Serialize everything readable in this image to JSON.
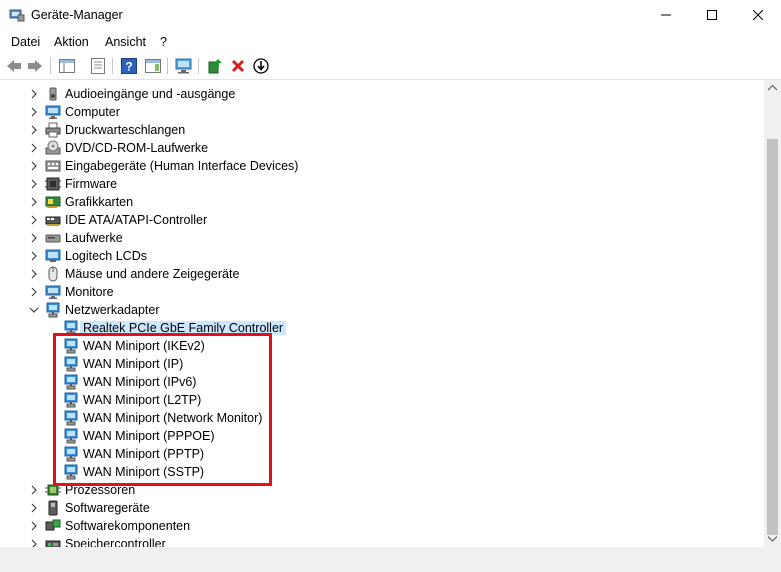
{
  "window": {
    "title": "Geräte-Manager"
  },
  "menu": [
    "Datei",
    "Aktion",
    "Ansicht",
    "?"
  ],
  "tree": [
    {
      "label": "Audioeingänge und -ausgänge",
      "icon": "speaker-icon",
      "level": 1,
      "expanded": false
    },
    {
      "label": "Computer",
      "icon": "monitor-icon",
      "level": 1,
      "expanded": false
    },
    {
      "label": "Druckwarteschlangen",
      "icon": "printer-icon",
      "level": 1,
      "expanded": false
    },
    {
      "label": "DVD/CD-ROM-Laufwerke",
      "icon": "dvd-drive-icon",
      "level": 1,
      "expanded": false
    },
    {
      "label": "Eingabegeräte (Human Interface Devices)",
      "icon": "hid-icon",
      "level": 1,
      "expanded": false
    },
    {
      "label": "Firmware",
      "icon": "chip-board-icon",
      "level": 1,
      "expanded": false
    },
    {
      "label": "Grafikkarten",
      "icon": "graphics-card-icon",
      "level": 1,
      "expanded": false
    },
    {
      "label": "IDE ATA/ATAPI-Controller",
      "icon": "ide-controller-icon",
      "level": 1,
      "expanded": false
    },
    {
      "label": "Laufwerke",
      "icon": "disk-drive-icon",
      "level": 1,
      "expanded": false
    },
    {
      "label": "Logitech LCDs",
      "icon": "lcd-icon",
      "level": 1,
      "expanded": false
    },
    {
      "label": "Mäuse und andere Zeigegeräte",
      "icon": "mouse-icon",
      "level": 1,
      "expanded": false
    },
    {
      "label": "Monitore",
      "icon": "monitor-icon",
      "level": 1,
      "expanded": false
    },
    {
      "label": "Netzwerkadapter",
      "icon": "network-adapter-icon",
      "level": 1,
      "expanded": true
    },
    {
      "label": "Realtek PCIe GbE Family Controller",
      "icon": "network-adapter-icon",
      "level": 2,
      "selected": true
    },
    {
      "label": "WAN Miniport (IKEv2)",
      "icon": "network-adapter-icon",
      "level": 2
    },
    {
      "label": "WAN Miniport (IP)",
      "icon": "network-adapter-icon",
      "level": 2
    },
    {
      "label": "WAN Miniport (IPv6)",
      "icon": "network-adapter-icon",
      "level": 2
    },
    {
      "label": "WAN Miniport (L2TP)",
      "icon": "network-adapter-icon",
      "level": 2
    },
    {
      "label": "WAN Miniport (Network Monitor)",
      "icon": "network-adapter-icon",
      "level": 2
    },
    {
      "label": "WAN Miniport (PPPOE)",
      "icon": "network-adapter-icon",
      "level": 2
    },
    {
      "label": "WAN Miniport (PPTP)",
      "icon": "network-adapter-icon",
      "level": 2
    },
    {
      "label": "WAN Miniport (SSTP)",
      "icon": "network-adapter-icon",
      "level": 2
    },
    {
      "label": "Prozessoren",
      "icon": "processor-icon",
      "level": 1,
      "expanded": false
    },
    {
      "label": "Softwaregeräte",
      "icon": "software-device-icon",
      "level": 1,
      "expanded": false
    },
    {
      "label": "Softwarekomponenten",
      "icon": "software-component-icon",
      "level": 1,
      "expanded": false
    },
    {
      "label": "Speichercontroller",
      "icon": "storage-controller-icon",
      "level": 1,
      "expanded": false
    }
  ],
  "colors": {
    "highlight": "#e3101c",
    "selection": "#cce8ff",
    "accent": "#1e7dd7"
  }
}
